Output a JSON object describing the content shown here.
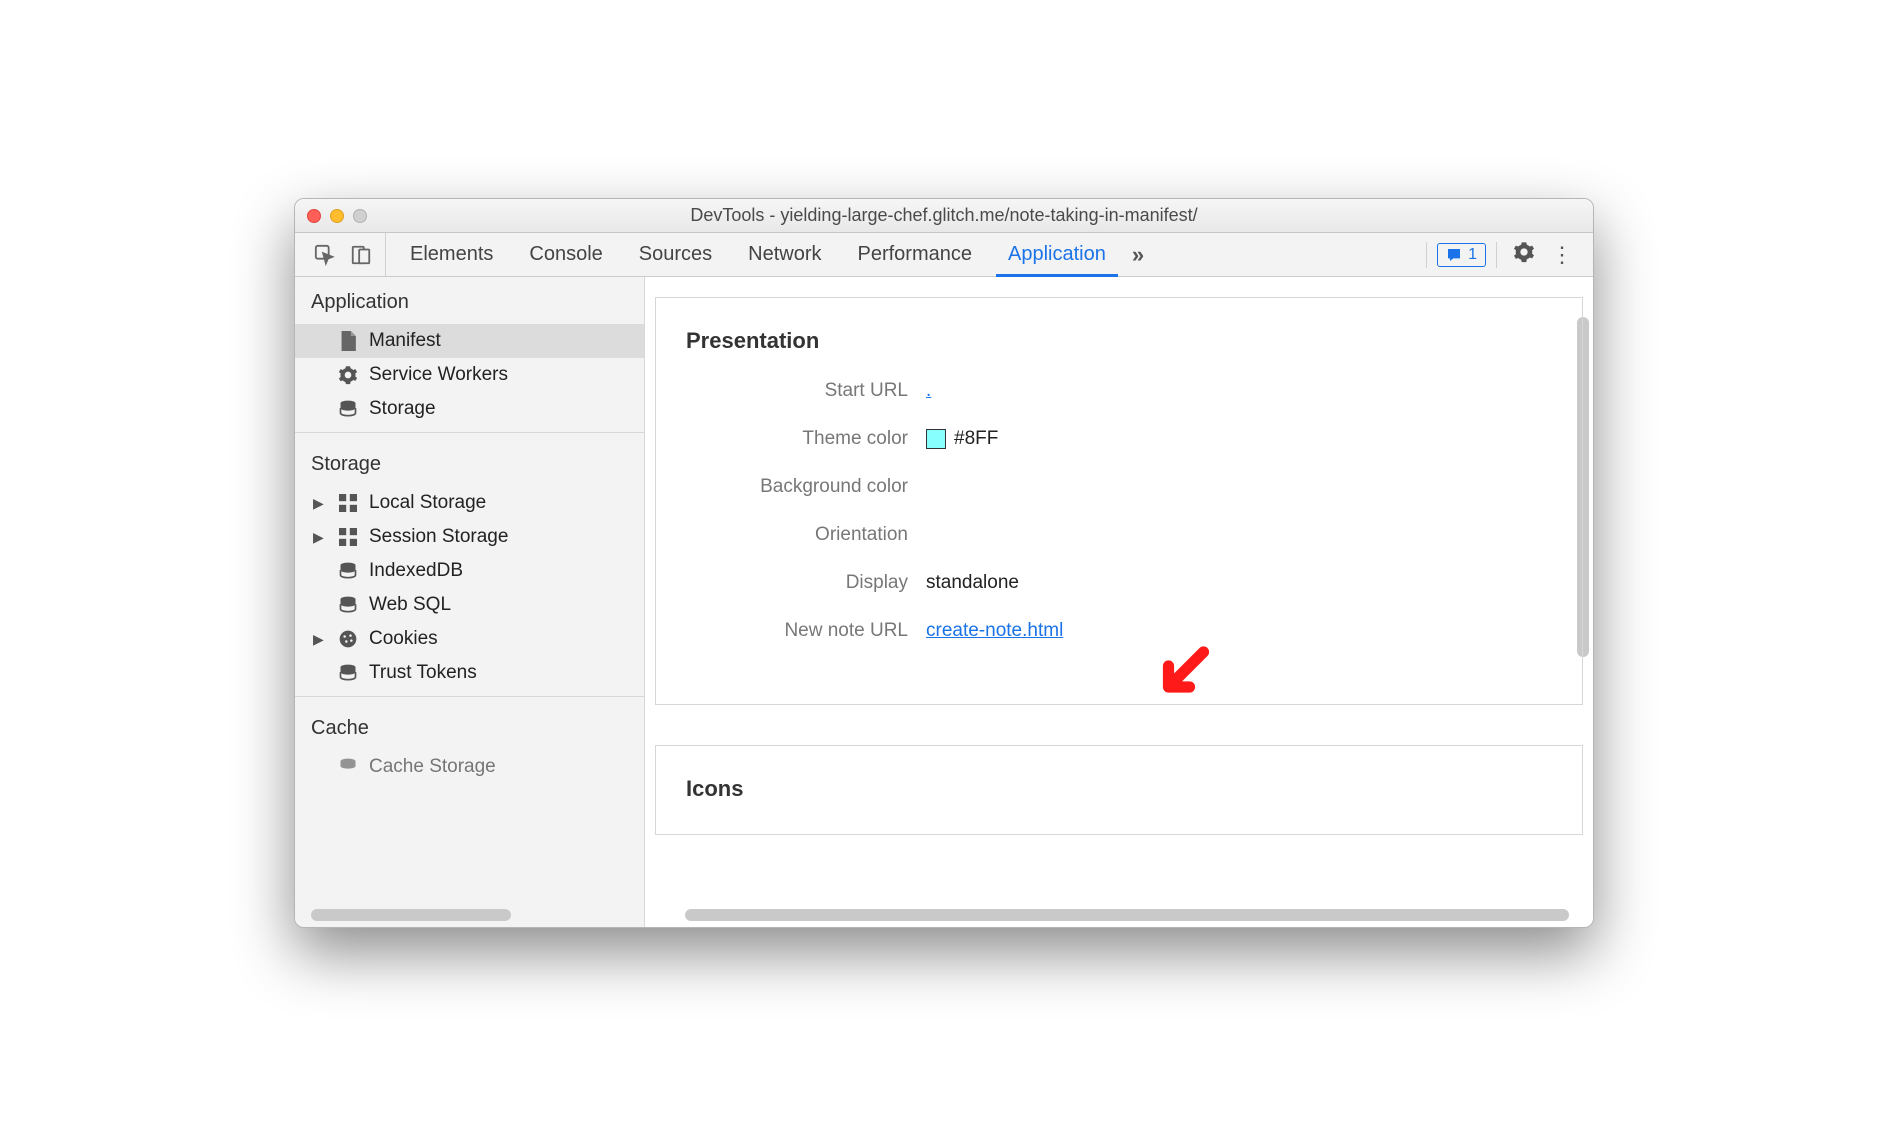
{
  "titlebar": {
    "title": "DevTools - yielding-large-chef.glitch.me/note-taking-in-manifest/"
  },
  "toolbar": {
    "tabs": [
      "Elements",
      "Console",
      "Sources",
      "Network",
      "Performance",
      "Application"
    ],
    "active_tab": "Application",
    "more": "»",
    "badge_count": "1"
  },
  "sidebar": {
    "groups": [
      {
        "head": "Application",
        "items": [
          {
            "icon": "file",
            "label": "Manifest",
            "selected": true
          },
          {
            "icon": "gear",
            "label": "Service Workers"
          },
          {
            "icon": "db",
            "label": "Storage"
          }
        ]
      },
      {
        "head": "Storage",
        "items": [
          {
            "icon": "grid",
            "label": "Local Storage",
            "caret": true
          },
          {
            "icon": "grid",
            "label": "Session Storage",
            "caret": true
          },
          {
            "icon": "db",
            "label": "IndexedDB"
          },
          {
            "icon": "db",
            "label": "Web SQL"
          },
          {
            "icon": "cookie",
            "label": "Cookies",
            "caret": true
          },
          {
            "icon": "db",
            "label": "Trust Tokens"
          }
        ]
      },
      {
        "head": "Cache",
        "items": [
          {
            "icon": "db",
            "label": "Cache Storage"
          }
        ]
      }
    ]
  },
  "main": {
    "presentation_head": "Presentation",
    "icons_head": "Icons",
    "rows": {
      "start_url": {
        "label": "Start URL",
        "value": "."
      },
      "theme_color": {
        "label": "Theme color",
        "value": "#8FF",
        "swatch": "#88ffff"
      },
      "bg_color": {
        "label": "Background color",
        "value": ""
      },
      "orientation": {
        "label": "Orientation",
        "value": ""
      },
      "display": {
        "label": "Display",
        "value": "standalone"
      },
      "new_note": {
        "label": "New note URL",
        "value": "create-note.html"
      }
    }
  }
}
